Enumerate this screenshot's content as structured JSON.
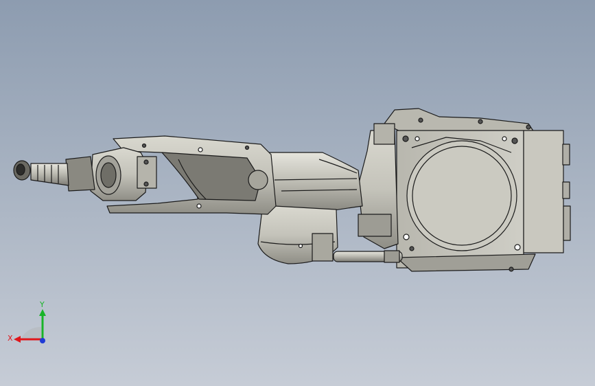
{
  "viewport": {
    "background_top": "#8d9cb0",
    "background_bottom": "#c6ccd6",
    "model": {
      "body_color": "#c7c6bd",
      "shade_color": "#8f8e86",
      "edge_color": "#1a1a1a"
    },
    "triad": {
      "x_label": "X",
      "y_label": "Y",
      "x_color": "#e0161b",
      "y_color": "#19b428",
      "z_color": "#1f3bd6"
    }
  }
}
